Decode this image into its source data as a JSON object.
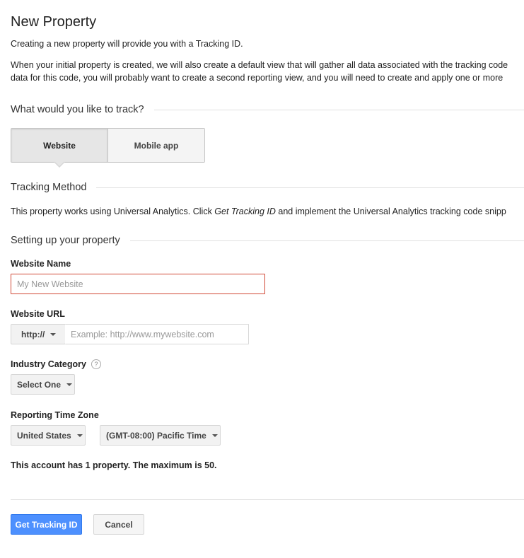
{
  "page": {
    "title": "New Property",
    "intro": "Creating a new property will provide you with a Tracking ID.",
    "views_line1": "When your initial property is created, we will also create a default view that will gather all data associated with the tracking code",
    "views_line2": "data for this code, you will probably want to create a second reporting view, and you will need to create and apply one or more"
  },
  "track_section": {
    "title": "What would you like to track?",
    "options": [
      {
        "label": "Website",
        "selected": true
      },
      {
        "label": "Mobile app",
        "selected": false
      }
    ]
  },
  "method_section": {
    "title": "Tracking Method",
    "text_before": "This property works using Universal Analytics. Click ",
    "text_em": "Get Tracking ID",
    "text_after": " and implement the Universal Analytics tracking code snipp"
  },
  "setup_section": {
    "title": "Setting up your property",
    "website_name": {
      "label": "Website Name",
      "value": "",
      "placeholder": "My New Website"
    },
    "website_url": {
      "label": "Website URL",
      "protocol": "http://",
      "value": "",
      "placeholder": "Example: http://www.mywebsite.com"
    },
    "industry": {
      "label": "Industry Category",
      "help": "?",
      "selected": "Select One"
    },
    "timezone": {
      "label": "Reporting Time Zone",
      "country": "United States",
      "zone": "(GMT-08:00) Pacific Time"
    },
    "limit_text": "This account has 1 property. The maximum is 50."
  },
  "actions": {
    "primary_label": "Get Tracking ID",
    "cancel_label": "Cancel"
  },
  "colors": {
    "primary_button": "#4d90fe",
    "error_border": "#d14836"
  }
}
